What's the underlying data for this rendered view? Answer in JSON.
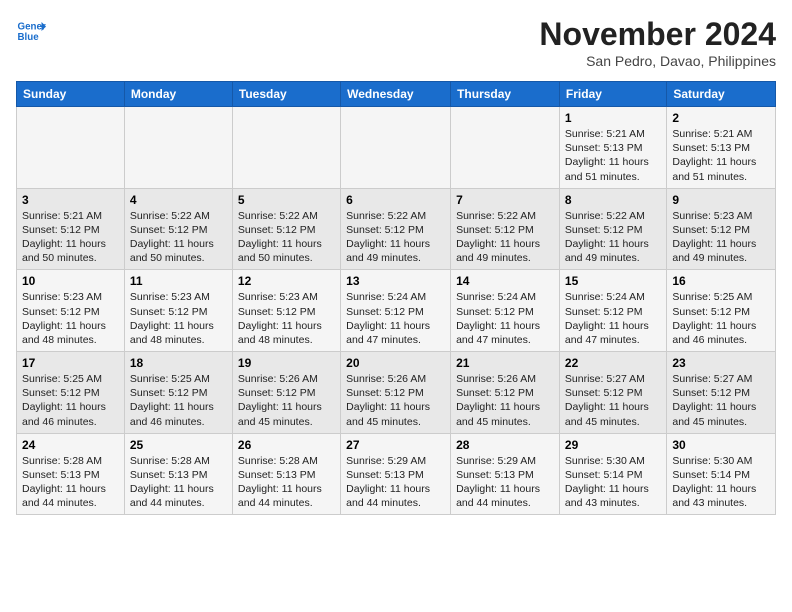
{
  "header": {
    "logo_line1": "General",
    "logo_line2": "Blue",
    "month_year": "November 2024",
    "location": "San Pedro, Davao, Philippines"
  },
  "calendar": {
    "days_of_week": [
      "Sunday",
      "Monday",
      "Tuesday",
      "Wednesday",
      "Thursday",
      "Friday",
      "Saturday"
    ],
    "weeks": [
      [
        {
          "day": "",
          "info": ""
        },
        {
          "day": "",
          "info": ""
        },
        {
          "day": "",
          "info": ""
        },
        {
          "day": "",
          "info": ""
        },
        {
          "day": "",
          "info": ""
        },
        {
          "day": "1",
          "info": "Sunrise: 5:21 AM\nSunset: 5:13 PM\nDaylight: 11 hours\nand 51 minutes."
        },
        {
          "day": "2",
          "info": "Sunrise: 5:21 AM\nSunset: 5:13 PM\nDaylight: 11 hours\nand 51 minutes."
        }
      ],
      [
        {
          "day": "3",
          "info": "Sunrise: 5:21 AM\nSunset: 5:12 PM\nDaylight: 11 hours\nand 50 minutes."
        },
        {
          "day": "4",
          "info": "Sunrise: 5:22 AM\nSunset: 5:12 PM\nDaylight: 11 hours\nand 50 minutes."
        },
        {
          "day": "5",
          "info": "Sunrise: 5:22 AM\nSunset: 5:12 PM\nDaylight: 11 hours\nand 50 minutes."
        },
        {
          "day": "6",
          "info": "Sunrise: 5:22 AM\nSunset: 5:12 PM\nDaylight: 11 hours\nand 49 minutes."
        },
        {
          "day": "7",
          "info": "Sunrise: 5:22 AM\nSunset: 5:12 PM\nDaylight: 11 hours\nand 49 minutes."
        },
        {
          "day": "8",
          "info": "Sunrise: 5:22 AM\nSunset: 5:12 PM\nDaylight: 11 hours\nand 49 minutes."
        },
        {
          "day": "9",
          "info": "Sunrise: 5:23 AM\nSunset: 5:12 PM\nDaylight: 11 hours\nand 49 minutes."
        }
      ],
      [
        {
          "day": "10",
          "info": "Sunrise: 5:23 AM\nSunset: 5:12 PM\nDaylight: 11 hours\nand 48 minutes."
        },
        {
          "day": "11",
          "info": "Sunrise: 5:23 AM\nSunset: 5:12 PM\nDaylight: 11 hours\nand 48 minutes."
        },
        {
          "day": "12",
          "info": "Sunrise: 5:23 AM\nSunset: 5:12 PM\nDaylight: 11 hours\nand 48 minutes."
        },
        {
          "day": "13",
          "info": "Sunrise: 5:24 AM\nSunset: 5:12 PM\nDaylight: 11 hours\nand 47 minutes."
        },
        {
          "day": "14",
          "info": "Sunrise: 5:24 AM\nSunset: 5:12 PM\nDaylight: 11 hours\nand 47 minutes."
        },
        {
          "day": "15",
          "info": "Sunrise: 5:24 AM\nSunset: 5:12 PM\nDaylight: 11 hours\nand 47 minutes."
        },
        {
          "day": "16",
          "info": "Sunrise: 5:25 AM\nSunset: 5:12 PM\nDaylight: 11 hours\nand 46 minutes."
        }
      ],
      [
        {
          "day": "17",
          "info": "Sunrise: 5:25 AM\nSunset: 5:12 PM\nDaylight: 11 hours\nand 46 minutes."
        },
        {
          "day": "18",
          "info": "Sunrise: 5:25 AM\nSunset: 5:12 PM\nDaylight: 11 hours\nand 46 minutes."
        },
        {
          "day": "19",
          "info": "Sunrise: 5:26 AM\nSunset: 5:12 PM\nDaylight: 11 hours\nand 45 minutes."
        },
        {
          "day": "20",
          "info": "Sunrise: 5:26 AM\nSunset: 5:12 PM\nDaylight: 11 hours\nand 45 minutes."
        },
        {
          "day": "21",
          "info": "Sunrise: 5:26 AM\nSunset: 5:12 PM\nDaylight: 11 hours\nand 45 minutes."
        },
        {
          "day": "22",
          "info": "Sunrise: 5:27 AM\nSunset: 5:12 PM\nDaylight: 11 hours\nand 45 minutes."
        },
        {
          "day": "23",
          "info": "Sunrise: 5:27 AM\nSunset: 5:12 PM\nDaylight: 11 hours\nand 45 minutes."
        }
      ],
      [
        {
          "day": "24",
          "info": "Sunrise: 5:28 AM\nSunset: 5:13 PM\nDaylight: 11 hours\nand 44 minutes."
        },
        {
          "day": "25",
          "info": "Sunrise: 5:28 AM\nSunset: 5:13 PM\nDaylight: 11 hours\nand 44 minutes."
        },
        {
          "day": "26",
          "info": "Sunrise: 5:28 AM\nSunset: 5:13 PM\nDaylight: 11 hours\nand 44 minutes."
        },
        {
          "day": "27",
          "info": "Sunrise: 5:29 AM\nSunset: 5:13 PM\nDaylight: 11 hours\nand 44 minutes."
        },
        {
          "day": "28",
          "info": "Sunrise: 5:29 AM\nSunset: 5:13 PM\nDaylight: 11 hours\nand 44 minutes."
        },
        {
          "day": "29",
          "info": "Sunrise: 5:30 AM\nSunset: 5:14 PM\nDaylight: 11 hours\nand 43 minutes."
        },
        {
          "day": "30",
          "info": "Sunrise: 5:30 AM\nSunset: 5:14 PM\nDaylight: 11 hours\nand 43 minutes."
        }
      ]
    ]
  }
}
